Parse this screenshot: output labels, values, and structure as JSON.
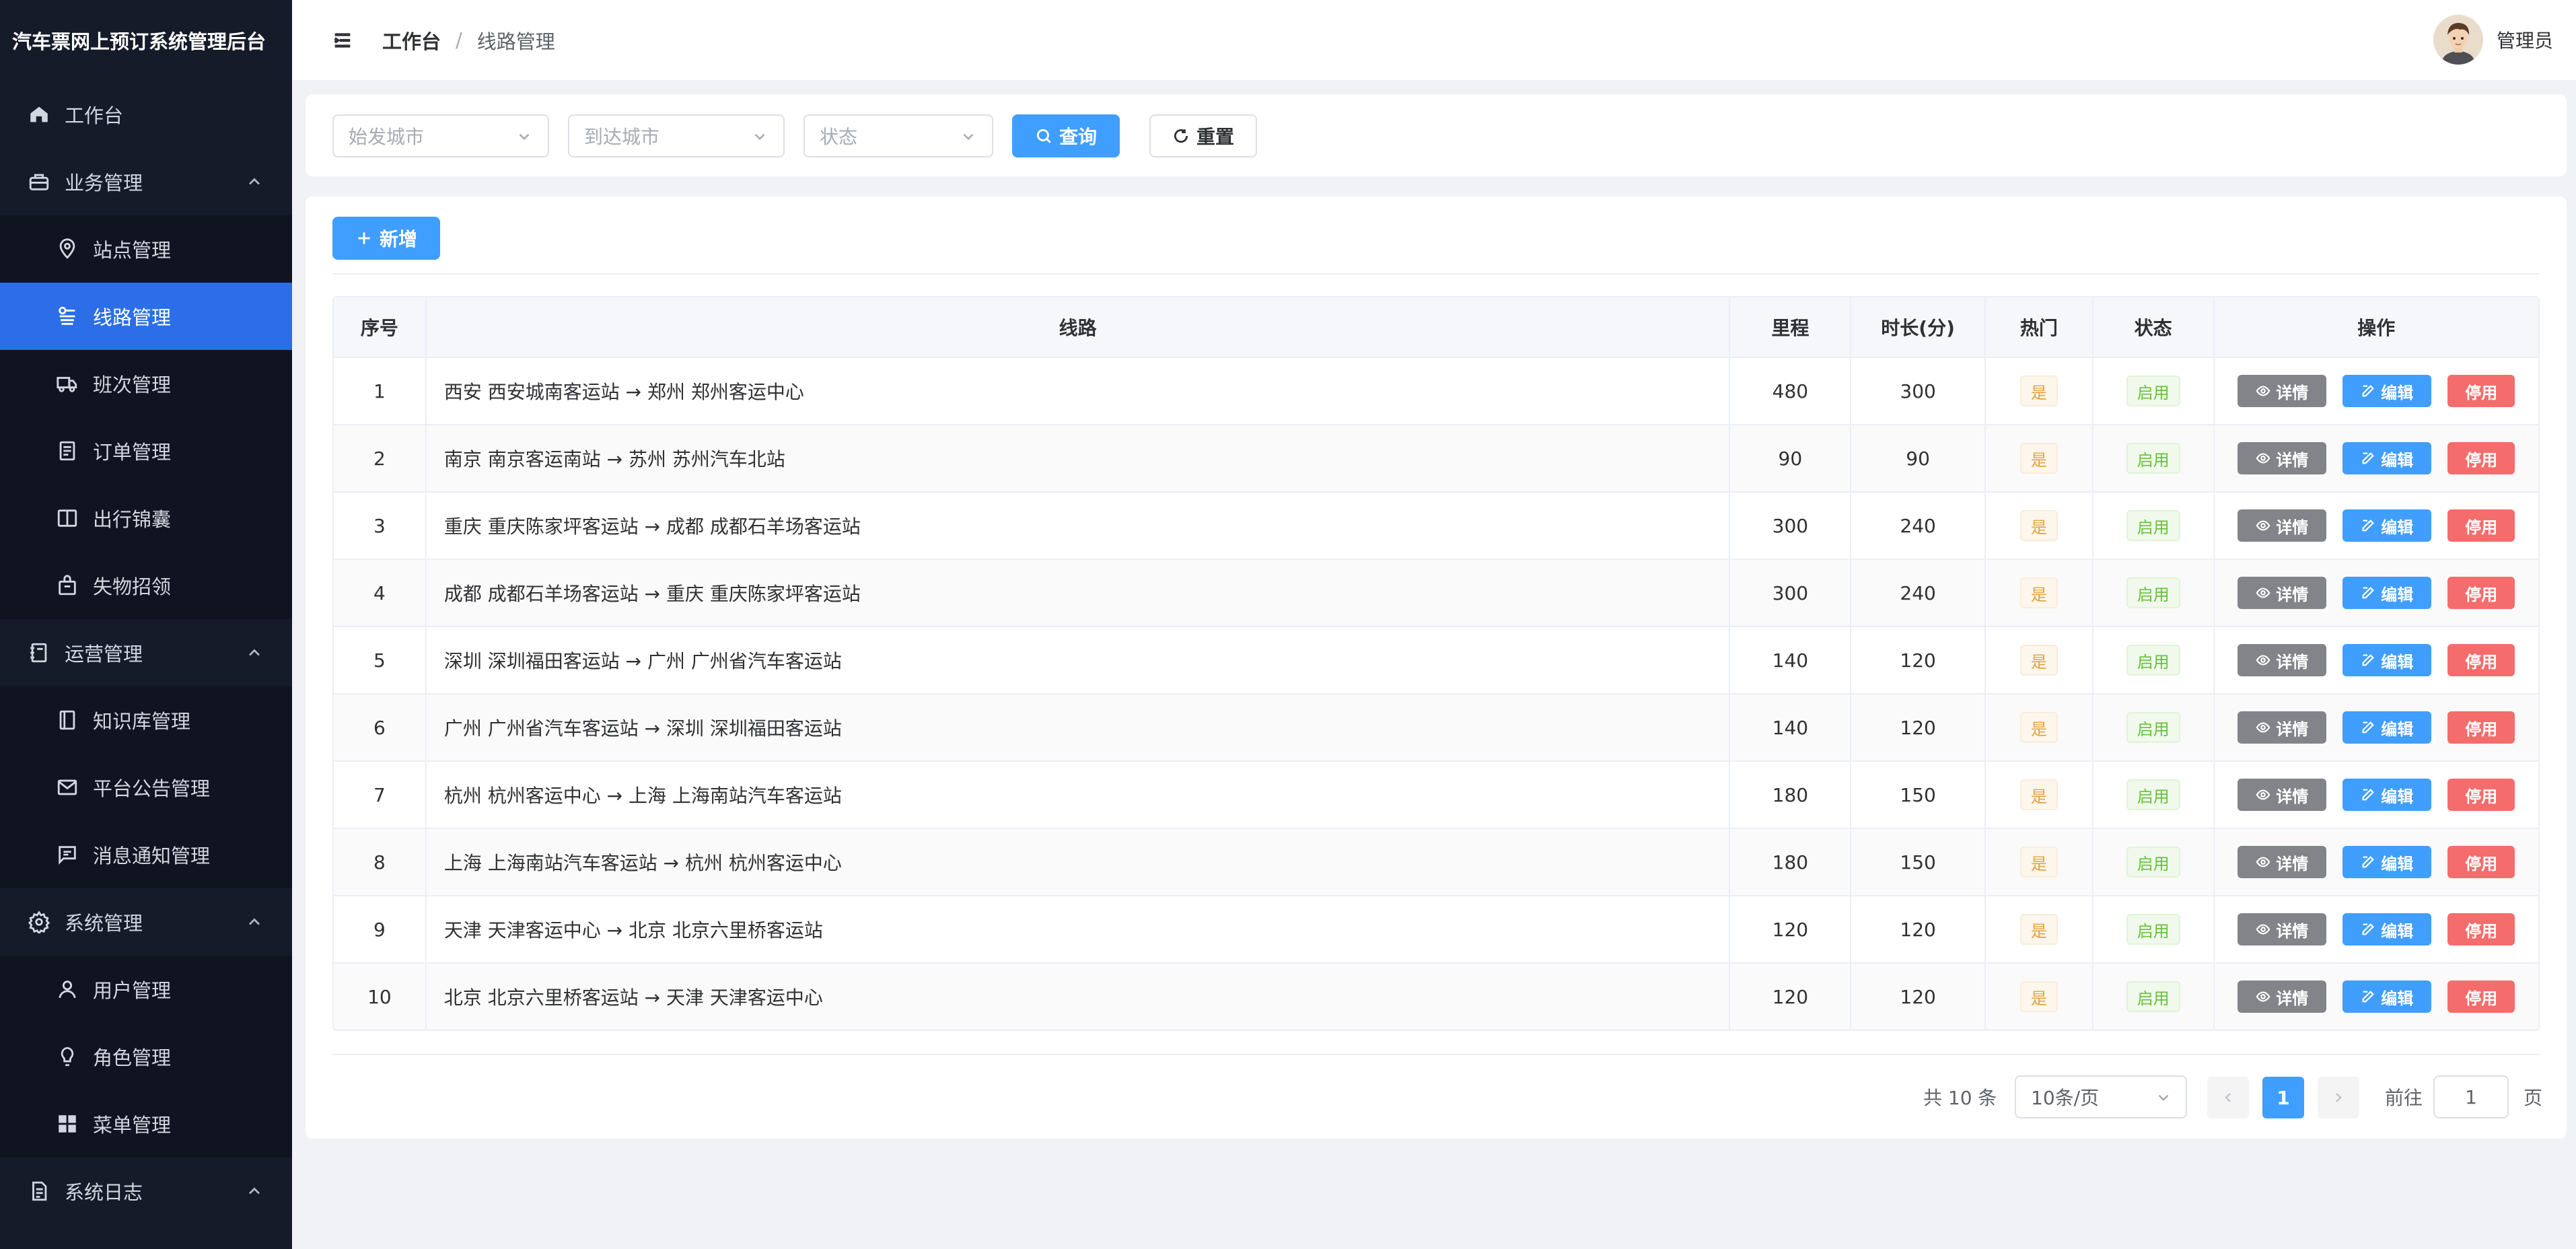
{
  "app": {
    "title": "汽车票网上预订系统管理后台"
  },
  "sidebar": {
    "items": [
      {
        "label": "工作台",
        "icon": "home-icon",
        "level": 1,
        "expandable": false,
        "active": false
      },
      {
        "label": "业务管理",
        "icon": "briefcase-icon",
        "level": 1,
        "expandable": true,
        "active": false
      },
      {
        "label": "站点管理",
        "icon": "location-icon",
        "level": 2,
        "expandable": false,
        "active": false
      },
      {
        "label": "线路管理",
        "icon": "route-icon",
        "level": 2,
        "expandable": false,
        "active": true
      },
      {
        "label": "班次管理",
        "icon": "truck-icon",
        "level": 2,
        "expandable": false,
        "active": false
      },
      {
        "label": "订单管理",
        "icon": "document-icon",
        "level": 2,
        "expandable": false,
        "active": false
      },
      {
        "label": "出行锦囊",
        "icon": "book-icon",
        "level": 2,
        "expandable": false,
        "active": false
      },
      {
        "label": "失物招领",
        "icon": "bag-icon",
        "level": 2,
        "expandable": false,
        "active": false
      },
      {
        "label": "运营管理",
        "icon": "notebook-icon",
        "level": 1,
        "expandable": true,
        "active": false
      },
      {
        "label": "知识库管理",
        "icon": "library-icon",
        "level": 2,
        "expandable": false,
        "active": false
      },
      {
        "label": "平台公告管理",
        "icon": "mail-icon",
        "level": 2,
        "expandable": false,
        "active": false
      },
      {
        "label": "消息通知管理",
        "icon": "message-icon",
        "level": 2,
        "expandable": false,
        "active": false
      },
      {
        "label": "系统管理",
        "icon": "gear-icon",
        "level": 1,
        "expandable": true,
        "active": false
      },
      {
        "label": "用户管理",
        "icon": "user-icon",
        "level": 2,
        "expandable": false,
        "active": false
      },
      {
        "label": "角色管理",
        "icon": "bulb-icon",
        "level": 2,
        "expandable": false,
        "active": false
      },
      {
        "label": "菜单管理",
        "icon": "grid-icon",
        "level": 2,
        "expandable": false,
        "active": false
      },
      {
        "label": "系统日志",
        "icon": "log-icon",
        "level": 1,
        "expandable": true,
        "active": false
      }
    ]
  },
  "header": {
    "breadcrumb_home": "工作台",
    "breadcrumb_sep": "/",
    "breadcrumb_current": "线路管理",
    "user_name": "管理员"
  },
  "search": {
    "from_city_placeholder": "始发城市",
    "to_city_placeholder": "到达城市",
    "status_placeholder": "状态",
    "query_label": "查询",
    "reset_label": "重置"
  },
  "toolbar": {
    "add_label": "新增"
  },
  "table": {
    "columns": [
      "序号",
      "线路",
      "里程",
      "时长(分)",
      "热门",
      "状态",
      "操作"
    ],
    "rows": [
      {
        "index": "1",
        "route": "西安 西安城南客运站 → 郑州 郑州客运中心",
        "mileage": "480",
        "duration": "300",
        "hot": "是",
        "status": "启用"
      },
      {
        "index": "2",
        "route": "南京 南京客运南站 → 苏州 苏州汽车北站",
        "mileage": "90",
        "duration": "90",
        "hot": "是",
        "status": "启用"
      },
      {
        "index": "3",
        "route": "重庆 重庆陈家坪客运站 → 成都 成都石羊场客运站",
        "mileage": "300",
        "duration": "240",
        "hot": "是",
        "status": "启用"
      },
      {
        "index": "4",
        "route": "成都 成都石羊场客运站 → 重庆 重庆陈家坪客运站",
        "mileage": "300",
        "duration": "240",
        "hot": "是",
        "status": "启用"
      },
      {
        "index": "5",
        "route": "深圳 深圳福田客运站 → 广州 广州省汽车客运站",
        "mileage": "140",
        "duration": "120",
        "hot": "是",
        "status": "启用"
      },
      {
        "index": "6",
        "route": "广州 广州省汽车客运站 → 深圳 深圳福田客运站",
        "mileage": "140",
        "duration": "120",
        "hot": "是",
        "status": "启用"
      },
      {
        "index": "7",
        "route": "杭州 杭州客运中心 → 上海 上海南站汽车客运站",
        "mileage": "180",
        "duration": "150",
        "hot": "是",
        "status": "启用"
      },
      {
        "index": "8",
        "route": "上海 上海南站汽车客运站 → 杭州 杭州客运中心",
        "mileage": "180",
        "duration": "150",
        "hot": "是",
        "status": "启用"
      },
      {
        "index": "9",
        "route": "天津 天津客运中心 → 北京 北京六里桥客运站",
        "mileage": "120",
        "duration": "120",
        "hot": "是",
        "status": "启用"
      },
      {
        "index": "10",
        "route": "北京 北京六里桥客运站 → 天津 天津客运中心",
        "mileage": "120",
        "duration": "120",
        "hot": "是",
        "status": "启用"
      }
    ],
    "actions": {
      "detail": "详情",
      "edit": "编辑",
      "disable": "停用"
    }
  },
  "pagination": {
    "total_text": "共 10 条",
    "page_size": "10条/页",
    "current_page": "1",
    "goto_label": "前往",
    "goto_value": "1",
    "page_suffix": "页"
  },
  "colors": {
    "sidebar_bg": "#151b29",
    "sidebar_active": "#2b6ee8",
    "primary": "#409eff",
    "danger": "#f56c6c",
    "info": "#82848a",
    "warning": "#e6a23c",
    "success": "#67c23a"
  }
}
